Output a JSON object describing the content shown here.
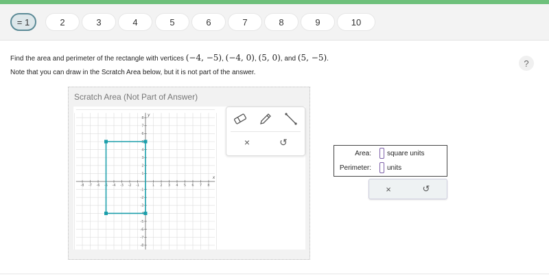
{
  "nav": {
    "questions": [
      "= 1",
      "2",
      "3",
      "4",
      "5",
      "6",
      "7",
      "8",
      "9",
      "10"
    ],
    "current_marker": "="
  },
  "question": {
    "prefix": "Find the area and perimeter of the rectangle with vertices",
    "v1": "(−4, −5)",
    "v2": "(−4, 0)",
    "v3": "(5, 0)",
    "v4": "(5, −5)",
    "sep1": ",",
    "sep2": ",",
    "and": ", and",
    "end": ".",
    "note": "Note that you can draw in the Scratch Area below, but it is not part of the answer."
  },
  "help": {
    "label": "?"
  },
  "scratch": {
    "title": "Scratch Area (Not Part of Answer)",
    "grid": {
      "xlabel": "x",
      "ylabel": "y",
      "x_ticks": [
        "-8",
        "-7",
        "-6",
        "-5",
        "-4",
        "-3",
        "-2",
        "-1",
        "1",
        "2",
        "3",
        "4",
        "5",
        "6",
        "7",
        "8"
      ],
      "y_ticks": [
        "8",
        "7",
        "6",
        "5",
        "4",
        "3",
        "2",
        "1",
        "-1",
        "-2",
        "-3",
        "-4",
        "-5",
        "-6",
        "-7",
        "-8"
      ],
      "rectangle_vertices": [
        [
          -5,
          5
        ],
        [
          0,
          5
        ],
        [
          0,
          -4
        ],
        [
          -5,
          -4
        ]
      ],
      "rectangle_color": "#1a9eaa"
    }
  },
  "tools": {
    "eraser": "eraser-icon",
    "pencil": "pencil-icon",
    "line": "line-segment-icon",
    "clear_label": "×",
    "undo_label": "↺"
  },
  "answer": {
    "area_label": "Area:",
    "area_unit": "square units",
    "perimeter_label": "Perimeter:",
    "perimeter_unit": "units",
    "clear_label": "×",
    "undo_label": "↺",
    "input_border_color": "#7b5ea7"
  }
}
